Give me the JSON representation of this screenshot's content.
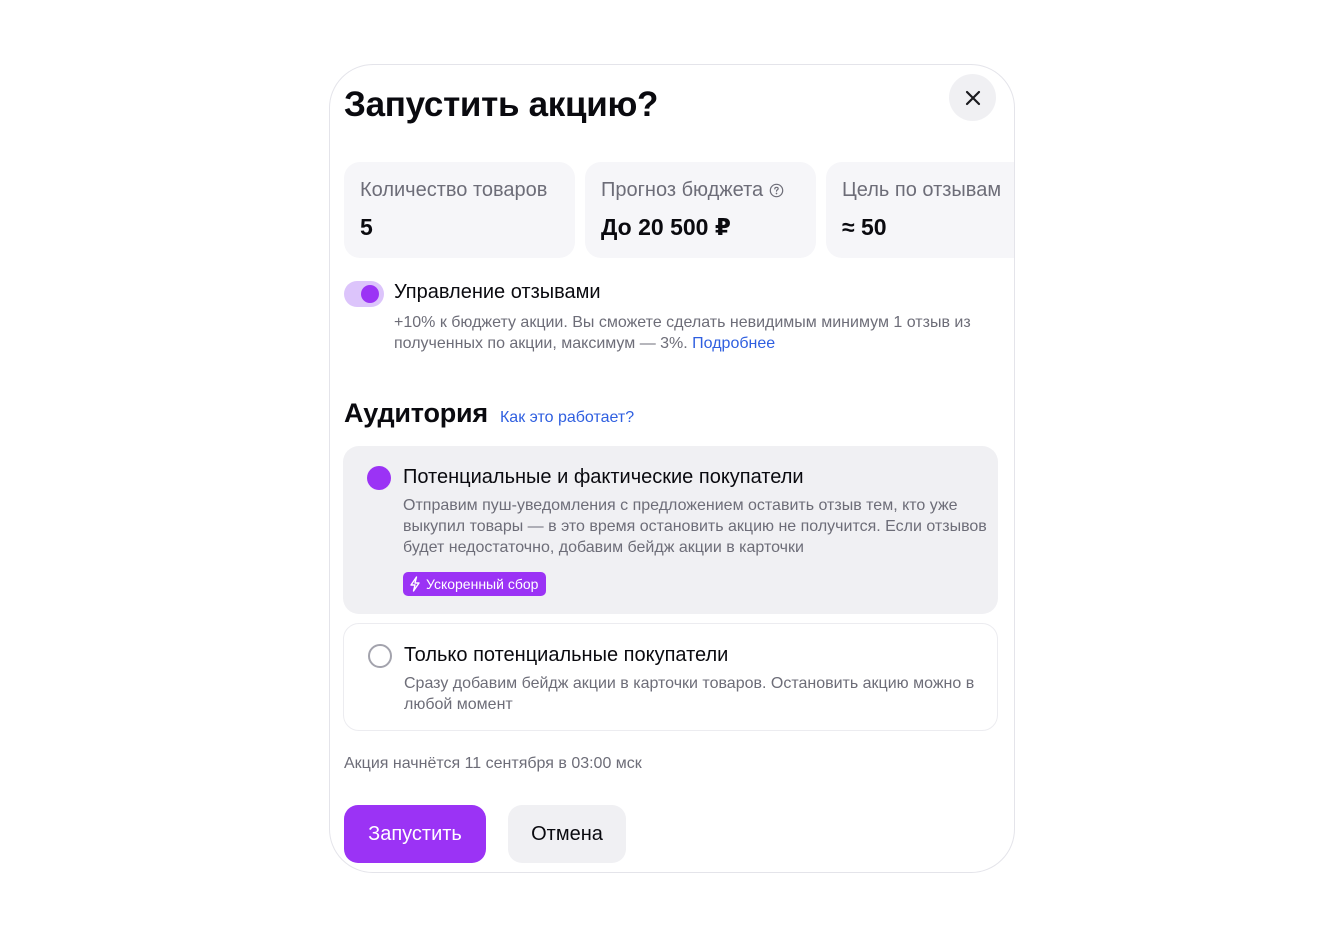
{
  "dialog": {
    "title": "Запустить акцию?",
    "close_icon": "close-icon"
  },
  "stats": [
    {
      "label": "Количество товаров",
      "value": "5"
    },
    {
      "label": "Прогноз бюджета",
      "value": "До 20 500 ₽",
      "icon": "help-circle-icon"
    },
    {
      "label": "Цель по отзывам",
      "value": "≈ 50"
    }
  ],
  "review_management": {
    "enabled": true,
    "label": "Управление отзывами",
    "description": "+10% к бюджету акции. Вы сможете сделать невидимым минимум 1 отзыв из полученных по акции, максимум — 3%.",
    "link": "Подробнее"
  },
  "audience": {
    "title": "Аудитория",
    "help_link": "Как это работает?",
    "options": [
      {
        "selected": true,
        "title": "Потенциальные и фактические покупатели",
        "description": "Отправим пуш-уведомления с предложением оставить отзыв тем, кто уже выкупил товары — в это время остановить акцию не получится. Если отзывов будет недостаточно, добавим бейдж акции в карточки",
        "badge": "Ускоренный сбор",
        "badge_icon": "lightning-icon"
      },
      {
        "selected": false,
        "title": "Только потенциальные покупатели",
        "description": "Сразу добавим бейдж акции в карточки товаров. Остановить акцию можно в любой момент"
      }
    ]
  },
  "start_note": "Акция начнётся 11 сентября в 03:00 мск",
  "actions": {
    "primary": "Запустить",
    "secondary": "Отмена"
  },
  "colors": {
    "accent": "#9b33f5",
    "link": "#2f5fe0",
    "muted_text": "#6d6d78"
  }
}
